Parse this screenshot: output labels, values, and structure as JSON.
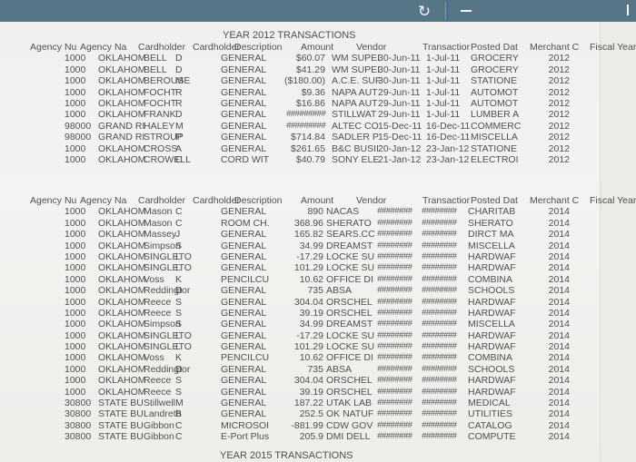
{
  "window": {
    "refresh_icon": "refresh-icon",
    "minimize_icon": "minimize-icon",
    "refresh_glyph": "↻"
  },
  "section_2012": {
    "title": "YEAR 2012 TRANSACTIONS",
    "headers": [
      "Agency Nu",
      "Agency Na",
      "Cardholder",
      "Cardholder",
      "Description",
      "Amount",
      "Vendor",
      "Transactior",
      "Posted Dat",
      "Merchant C",
      "Fiscal Year"
    ],
    "rows": [
      [
        "1000",
        "OKLAHOM",
        "BELL",
        "D",
        "GENERAL",
        "$60.07",
        "WM SUPEI",
        "30-Jun-11",
        "1-Jul-11",
        "GROCERY",
        "2012"
      ],
      [
        "1000",
        "OKLAHOM",
        "BELL",
        "D",
        "GENERAL",
        "$41.29",
        "WM SUPEI",
        "30-Jun-11",
        "1-Jul-11",
        "GROCERY",
        "2012"
      ],
      [
        "1000",
        "OKLAHOM",
        "BEROUSE",
        "M",
        "GENERAL",
        "($180.00)",
        "A.C.E. SUF",
        "30-Jun-11",
        "1-Jul-11",
        "STATIONE",
        "2012"
      ],
      [
        "1000",
        "OKLAHOM",
        "FOCHT",
        "R",
        "GENERAL",
        "$9.36",
        "NAPA AUT",
        "29-Jun-11",
        "1-Jul-11",
        "AUTOMOT",
        "2012"
      ],
      [
        "1000",
        "OKLAHOM",
        "FOCHT",
        "R",
        "GENERAL",
        "$16.86",
        "NAPA AUT",
        "29-Jun-11",
        "1-Jul-11",
        "AUTOMOT",
        "2012"
      ],
      [
        "1000",
        "OKLAHOM",
        "FRANK",
        "D",
        "GENERAL",
        "#########",
        "STILLWAT",
        "29-Jun-11",
        "1-Jul-11",
        "LUMBER A",
        "2012"
      ],
      [
        "98000",
        "GRAND RI",
        "HALEY",
        "M",
        "GENERAL",
        "#########",
        "ALTEC CO",
        "15-Dec-11",
        "16-Dec-11",
        "COMMERC",
        "2012"
      ],
      [
        "98000",
        "GRAND RI",
        "STROUP",
        "P",
        "GENERAL",
        "$714.84",
        "SADLER P",
        "15-Dec-11",
        "16-Dec-11",
        "MISCELLA",
        "2012"
      ],
      [
        "1000",
        "OKLAHOM",
        "CROSS",
        "A",
        "GENERAL",
        "$261.65",
        "B&C BUSII",
        "20-Jan-12",
        "23-Jan-12",
        "STATIONE",
        "2012"
      ],
      [
        "1000",
        "OKLAHOM",
        "CROWELL",
        "C",
        "CORD WIT",
        "$40.79",
        "SONY ELE",
        "21-Jan-12",
        "23-Jan-12",
        "ELECTROI",
        "2012"
      ]
    ]
  },
  "section_2014": {
    "headers": [
      "Agency Nu",
      "Agency Na",
      "Cardholder",
      "Cardholder",
      "Description",
      "Amount",
      "Vendor",
      "Transactior",
      "Posted Dat",
      "Merchant C",
      "Fiscal Year"
    ],
    "rows": [
      [
        "1000",
        "OKLAHOM",
        "Mason",
        "C",
        "GENERAL",
        "890",
        "NACAS",
        "########",
        "########",
        "CHARITAB",
        "2014"
      ],
      [
        "1000",
        "OKLAHOM",
        "Mason",
        "C",
        "ROOM CH.",
        "368.96",
        "SHERATO",
        "########",
        "########",
        "SHERATO",
        "2014"
      ],
      [
        "1000",
        "OKLAHOM",
        "Massey",
        "J",
        "GENERAL",
        "165.82",
        "SEARS.CC",
        "########",
        "########",
        "DIRCT MA",
        "2014"
      ],
      [
        "1000",
        "OKLAHOM",
        "Simpson",
        "S",
        "GENERAL",
        "34.99",
        "DREAMST",
        "########",
        "########",
        "MISCELLA",
        "2014"
      ],
      [
        "1000",
        "OKLAHOM",
        "SINGLETO",
        "L",
        "GENERAL",
        "-17.29",
        "LOCKE SU",
        "########",
        "########",
        "HARDWAF",
        "2014"
      ],
      [
        "1000",
        "OKLAHOM",
        "SINGLETO",
        "L",
        "GENERAL",
        "101.29",
        "LOCKE SU",
        "########",
        "########",
        "HARDWAF",
        "2014"
      ],
      [
        "1000",
        "OKLAHOM",
        "Voss",
        "K",
        "PENCILCU",
        "10.62",
        "OFFICE DI",
        "########",
        "########",
        "COMBINA",
        "2014"
      ],
      [
        "1000",
        "OKLAHOM",
        "Reddingtor",
        "D",
        "GENERAL",
        "735",
        "ABSA",
        "########",
        "########",
        "SCHOOLS",
        "2014"
      ],
      [
        "1000",
        "OKLAHOM",
        "Reece",
        "S",
        "GENERAL",
        "304.04",
        "ORSCHEL",
        "########",
        "########",
        "HARDWAF",
        "2014"
      ],
      [
        "1000",
        "OKLAHOM",
        "Reece",
        "S",
        "GENERAL",
        "39.19",
        "ORSCHEL",
        "########",
        "########",
        "HARDWAF",
        "2014"
      ],
      [
        "1000",
        "OKLAHOM",
        "Simpson",
        "S",
        "GENERAL",
        "34.99",
        "DREAMST",
        "########",
        "########",
        "MISCELLA",
        "2014"
      ],
      [
        "1000",
        "OKLAHOM",
        "SINGLETO",
        "L",
        "GENERAL",
        "-17.29",
        "LOCKE SU",
        "########",
        "########",
        "HARDWAF",
        "2014"
      ],
      [
        "1000",
        "OKLAHOM",
        "SINGLETO",
        "L",
        "GENERAL",
        "101.29",
        "LOCKE SU",
        "########",
        "########",
        "HARDWAF",
        "2014"
      ],
      [
        "1000",
        "OKLAHOM",
        "Voss",
        "K",
        "PENCILCU",
        "10.62",
        "OFFICE DI",
        "########",
        "########",
        "COMBINA",
        "2014"
      ],
      [
        "1000",
        "OKLAHOM",
        "Reddingtor",
        "D",
        "GENERAL",
        "735",
        "ABSA",
        "########",
        "########",
        "SCHOOLS",
        "2014"
      ],
      [
        "1000",
        "OKLAHOM",
        "Reece",
        "S",
        "GENERAL",
        "304.04",
        "ORSCHEL",
        "########",
        "########",
        "HARDWAF",
        "2014"
      ],
      [
        "1000",
        "OKLAHOM",
        "Reece",
        "S",
        "GENERAL",
        "39.19",
        "ORSCHEL",
        "########",
        "########",
        "HARDWAF",
        "2014"
      ],
      [
        "30800",
        "STATE BU",
        "Stillwell",
        "M",
        "GENERAL",
        "187.22",
        "UTAK LAB",
        "########",
        "########",
        "MEDICAL",
        "2014"
      ],
      [
        "30800",
        "STATE BU",
        "Landreth",
        "B",
        "GENERAL",
        "252.5",
        "OK NATUF",
        "########",
        "########",
        "UTILITIES",
        "2014"
      ],
      [
        "30800",
        "STATE BU",
        "Gibbon",
        "C",
        "MICROSOI",
        "-881.99",
        "CDW GOV",
        "########",
        "########",
        "CATALOG",
        "2014"
      ],
      [
        "30800",
        "STATE BU",
        "Gibbon",
        "C",
        "E-Port Plus",
        "205.9",
        "DMI  DELL",
        "########",
        "########",
        "COMPUTE",
        "2014"
      ]
    ]
  },
  "section_2015": {
    "title": "YEAR 2015 TRANSACTIONS"
  }
}
